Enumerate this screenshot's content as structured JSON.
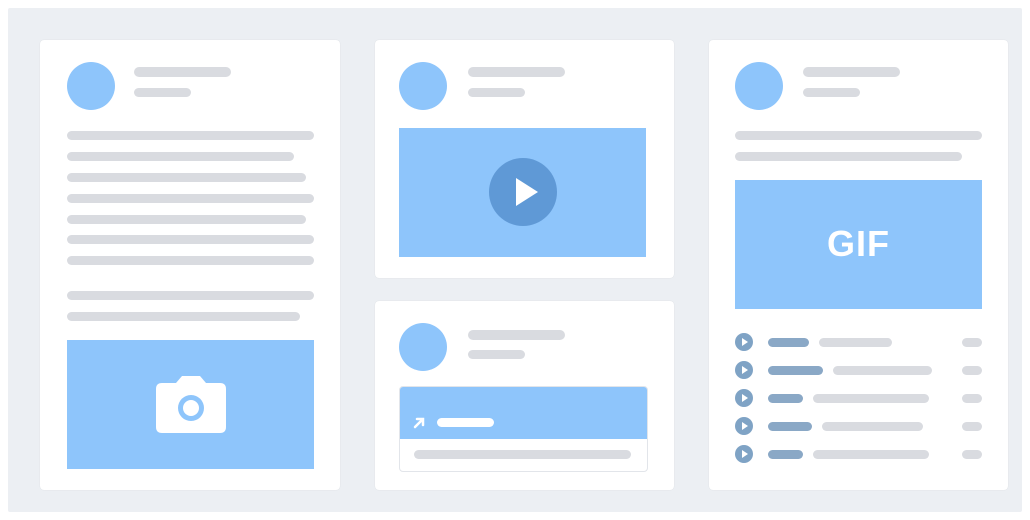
{
  "colors": {
    "background": "#eceff3",
    "card": "#ffffff",
    "accent_blue": "#8ec5fb",
    "play_button": "#5f99d6",
    "placeholder_line": "#d9dbe0",
    "track_icon": "#7fa3c5"
  },
  "cards": [
    {
      "name": "text-photo-post",
      "media": "camera-icon"
    },
    {
      "name": "video-post",
      "media": "play-icon"
    },
    {
      "name": "link-post",
      "media": "link-arrow-icon"
    },
    {
      "name": "gif-audio-post",
      "media": "gif-image"
    }
  ],
  "gif_card": {
    "gif_label": "GIF",
    "track_count": 5
  }
}
